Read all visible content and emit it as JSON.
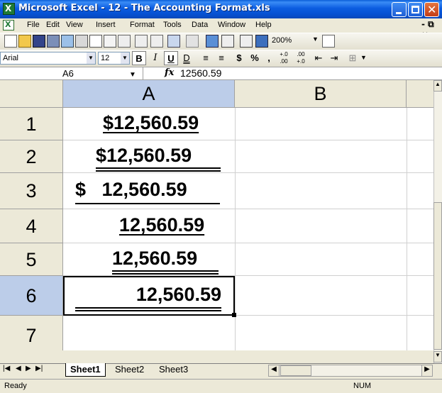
{
  "window": {
    "title": "Microsoft Excel - 12 - The Accounting Format.xls",
    "app_icon": "X"
  },
  "menu": [
    "File",
    "Edit",
    "View",
    "Insert",
    "Format",
    "Tools",
    "Data",
    "Window",
    "Help"
  ],
  "toolbar": {
    "zoom": "200%"
  },
  "format_toolbar": {
    "font": "Arial",
    "size": "12",
    "bold": "B",
    "italic": "I",
    "underline": "U",
    "double_underline": "D",
    "currency": "$",
    "percent": "%",
    "comma": ","
  },
  "formula_bar": {
    "name_box": "A6",
    "fx": "fx",
    "formula": "12560.59"
  },
  "columns": [
    "A",
    "B"
  ],
  "rows": [
    {
      "num": "1",
      "value": "$12,560.59",
      "format": "single-underline"
    },
    {
      "num": "2",
      "value": "$12,560.59",
      "format": "double-underline"
    },
    {
      "num": "3",
      "value": "$   12,560.59",
      "format": "accounting-single"
    },
    {
      "num": "4",
      "value": "12,560.59",
      "format": "single-underline"
    },
    {
      "num": "5",
      "value": "12,560.59",
      "format": "double-underline"
    },
    {
      "num": "6",
      "value": "12,560.59",
      "format": "accounting-double"
    },
    {
      "num": "7",
      "value": "",
      "format": ""
    }
  ],
  "active_cell": "A6",
  "sheets": [
    "Sheet1",
    "Sheet2",
    "Sheet3"
  ],
  "active_sheet": "Sheet1",
  "status": {
    "left": "Ready",
    "num": "NUM"
  }
}
